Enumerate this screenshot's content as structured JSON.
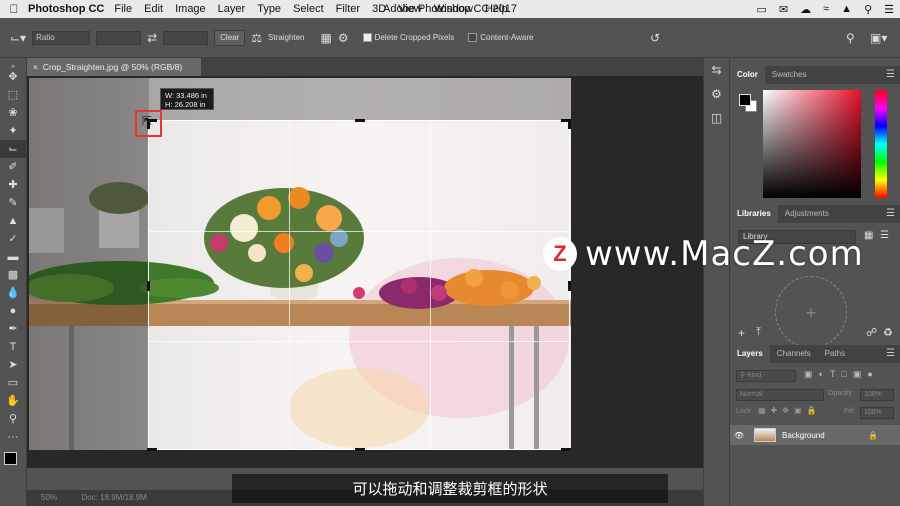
{
  "menubar": {
    "app_name": "Photoshop CC",
    "menus": [
      "File",
      "Edit",
      "Image",
      "Layer",
      "Type",
      "Select",
      "Filter",
      "3D",
      "View",
      "Window",
      "Help"
    ],
    "window_title": "Adobe Photoshop CC 2017"
  },
  "options": {
    "ratio_value": "Ratio",
    "clear_label": "Clear",
    "straighten_label": "Straighten",
    "delete_cropped_label": "Delete Cropped Pixels",
    "delete_cropped_checked": true,
    "content_aware_label": "Content-Aware",
    "content_aware_checked": false
  },
  "document": {
    "tab_title": "Crop_Straighten.jpg @ 50% (RGB/8)",
    "zoom": "50%",
    "doc_size": "Doc: 18.9M/18.9M"
  },
  "crop_tooltip": {
    "width": "W: 33.486 in",
    "height": "H: 26.208 in"
  },
  "panels": {
    "color_tabs": [
      "Color",
      "Swatches"
    ],
    "libraries_tabs": [
      "Libraries",
      "Adjustments"
    ],
    "library_select": "Library",
    "layers_tabs": [
      "Layers",
      "Channels",
      "Paths"
    ],
    "kind_filter": "Kind",
    "blend_mode": "Normal",
    "opacity_label": "Opacity:",
    "opacity_value": "100%",
    "lock_label": "Lock:",
    "fill_label": "Fill:",
    "fill_value": "100%",
    "layer_name": "Background"
  },
  "watermark": {
    "logo": "Z",
    "text": "www.MacZ.com"
  },
  "subtitle": "可以拖动和调整裁剪框的形状",
  "colors": {
    "accent_red": "#e03a2e",
    "foreground": "#000000",
    "background": "#ffffff"
  }
}
